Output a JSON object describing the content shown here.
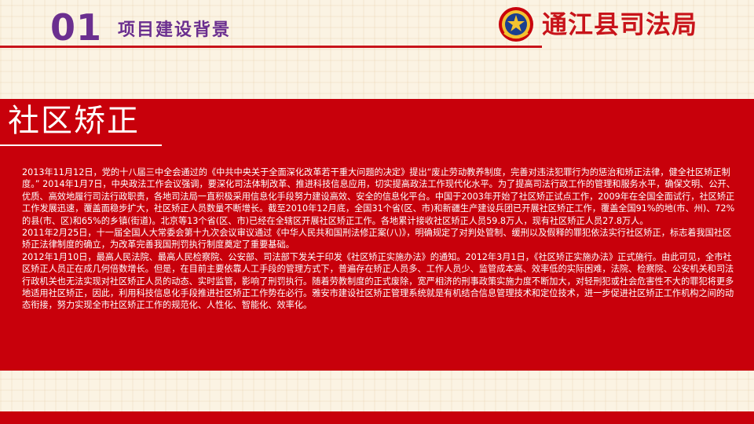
{
  "header": {
    "section_number": "01",
    "section_title": "项目建设背景",
    "brand_name": "通江县司法局"
  },
  "panel": {
    "title": "社区矫正",
    "paragraphs": [
      "2013年11月12日，党的十八届三中全会通过的《中共中央关于全面深化改革若干重大问题的决定》提出“废止劳动教养制度，完善对违法犯罪行为的惩治和矫正法律，健全社区矫正制度。” 2014年1月7日，中央政法工作会议强调，要深化司法体制改革、推进科技信息应用，切实提高政法工作现代化水平。为了提高司法行政工作的管理和服务水平，确保文明、公开、优质、高效地履行司法行政职责，各地司法局一直积极采用信息化手段努力建设高效、安全的信息化平台。中国于2003年开始了社区矫正试点工作，2009年在全国全面试行，社区矫正工作发展迅速，覆盖面稳步扩大，社区矫正人员数量不断增长。截至2010年12月底，全国31个省(区、市)和新疆生产建设兵团已开展社区矫正工作，覆盖全国91%的地(市、州)、72%的县(市、区)和65%的乡镇(街道)。北京等13个省(区、市)已经在全辖区开展社区矫正工作。各地累计接收社区矫正人员59.8万人，现有社区矫正人员27.8万人。",
      "2011年2月25日，十一届全国人大常委会第十九次会议审议通过《中华人民共和国刑法修正案(八)》，明确规定了对判处管制、缓刑以及假释的罪犯依法实行社区矫正，标志着我国社区矫正法律制度的确立，为改革完善我国刑罚执行制度奠定了重要基础。",
      "2012年1月10日，最高人民法院、最高人民检察院、公安部、司法部下发关于印发《社区矫正实施办法》的通知。2012年3月1日，《社区矫正实施办法》正式施行。由此可见，全市社区矫正人员正在成几何倍数增长。但是，在目前主要依靠人工手段的管理方式下，普遍存在矫正人员多、工作人员少、监管成本高、效率低的实际困难，法院、检察院、公安机关和司法行政机关也无法实现对社区矫正人员的动态、实时监管，影响了刑罚执行。随着劳教制度的正式废除，宽严相济的刑事政策实施力度不断加大，对轻刑犯或社会危害性不大的罪犯将更多地适用社区矫正，因此，利用科技信息化手段推进社区矫正工作势在必行。雅安市建设社区矫正管理系统就是有机结合信息管理技术和定位技术，进一步促进社区矫正工作机构之间的动态衔接，努力实现全市社区矫正工作的规范化、人性化、智能化、效率化。"
    ]
  },
  "colors": {
    "primary_red": "#c8000b",
    "accent_purple": "#6b2f8f",
    "emblem_gold": "#f2c230",
    "background_cream": "#fbf3e3"
  },
  "icons": {
    "emblem": "police-emblem-icon"
  }
}
